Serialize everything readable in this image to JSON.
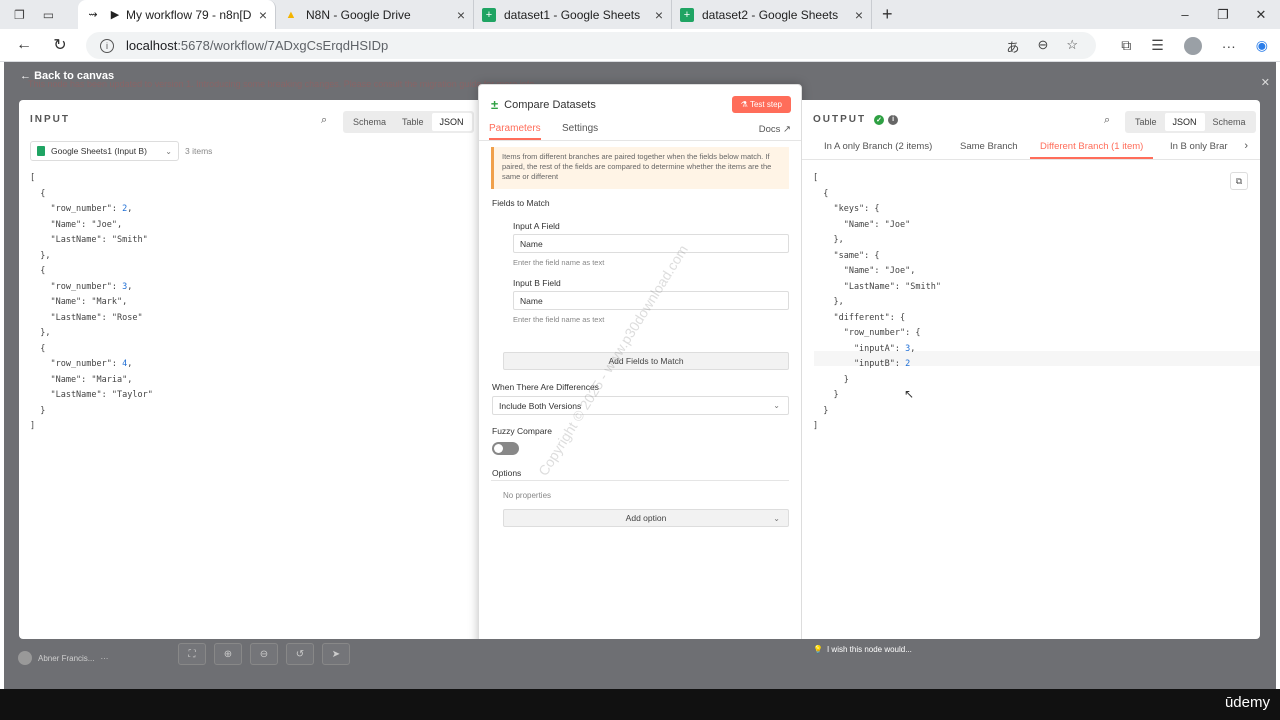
{
  "browser": {
    "tabs": [
      {
        "title": "My workflow 79 - n8n[DEV]",
        "active": true
      },
      {
        "title": "N8N - Google Drive",
        "active": false
      },
      {
        "title": "dataset1 - Google Sheets",
        "active": false
      },
      {
        "title": "dataset2 - Google Sheets",
        "active": false
      }
    ],
    "url_host": "localhost",
    "url_path": ":5678/workflow/7ADxgCsErqdHSIDp"
  },
  "header": {
    "back_label": "Back to canvas",
    "banner": "This node has been updated to version 1. Introducing some breaking changes. Please consult the migration guide for more info."
  },
  "input_panel": {
    "title": "INPUT",
    "view_tabs": [
      "Schema",
      "Table",
      "JSON"
    ],
    "active_view": "JSON",
    "source": "Google Sheets1 (Input B)",
    "item_count": "3 items",
    "items": [
      {
        "row_number": 2,
        "Name": "Joe",
        "LastName": "Smith"
      },
      {
        "row_number": 3,
        "Name": "Mark",
        "LastName": "Rose"
      },
      {
        "row_number": 4,
        "Name": "Maria",
        "LastName": "Taylor"
      }
    ]
  },
  "node": {
    "title": "Compare Datasets",
    "test_label": "Test step",
    "tabs": [
      "Parameters",
      "Settings"
    ],
    "active_tab": "Parameters",
    "docs_label": "Docs",
    "notice": "Items from different branches are paired together when the fields below match. If paired, the rest of the fields are compared to determine whether the items are the same or different",
    "fields_to_match_label": "Fields to Match",
    "input_a_label": "Input A Field",
    "input_a_value": "Name",
    "input_a_hint": "Enter the field name as text",
    "input_b_label": "Input B Field",
    "input_b_value": "Name",
    "input_b_hint": "Enter the field name as text",
    "add_fields_label": "Add Fields to Match",
    "differences_label": "When There Are Differences",
    "differences_value": "Include Both Versions",
    "fuzzy_label": "Fuzzy Compare",
    "fuzzy_on": false,
    "options_label": "Options",
    "no_properties": "No properties",
    "add_option_label": "Add option"
  },
  "output_panel": {
    "title": "OUTPUT",
    "view_tabs": [
      "Table",
      "JSON",
      "Schema"
    ],
    "active_view": "JSON",
    "branches": [
      "In A only Branch (2 items)",
      "Same Branch",
      "Different Branch (1 item)",
      "In B only Brar"
    ],
    "active_branch": "Different Branch (1 item)",
    "json": {
      "keys_name": "Joe",
      "same_name": "Joe",
      "same_lastname": "Smith",
      "inputA": 3,
      "inputB": 2
    }
  },
  "footer": {
    "user": "Abner Francis...",
    "wish_label": "I wish this node would...",
    "brand": "ūdemy"
  },
  "watermark": "Copyright © 2025 - www.p30download.com",
  "colors": {
    "accent": "#ff6d5a",
    "success": "#2ea043",
    "number": "#1f6fd6"
  }
}
